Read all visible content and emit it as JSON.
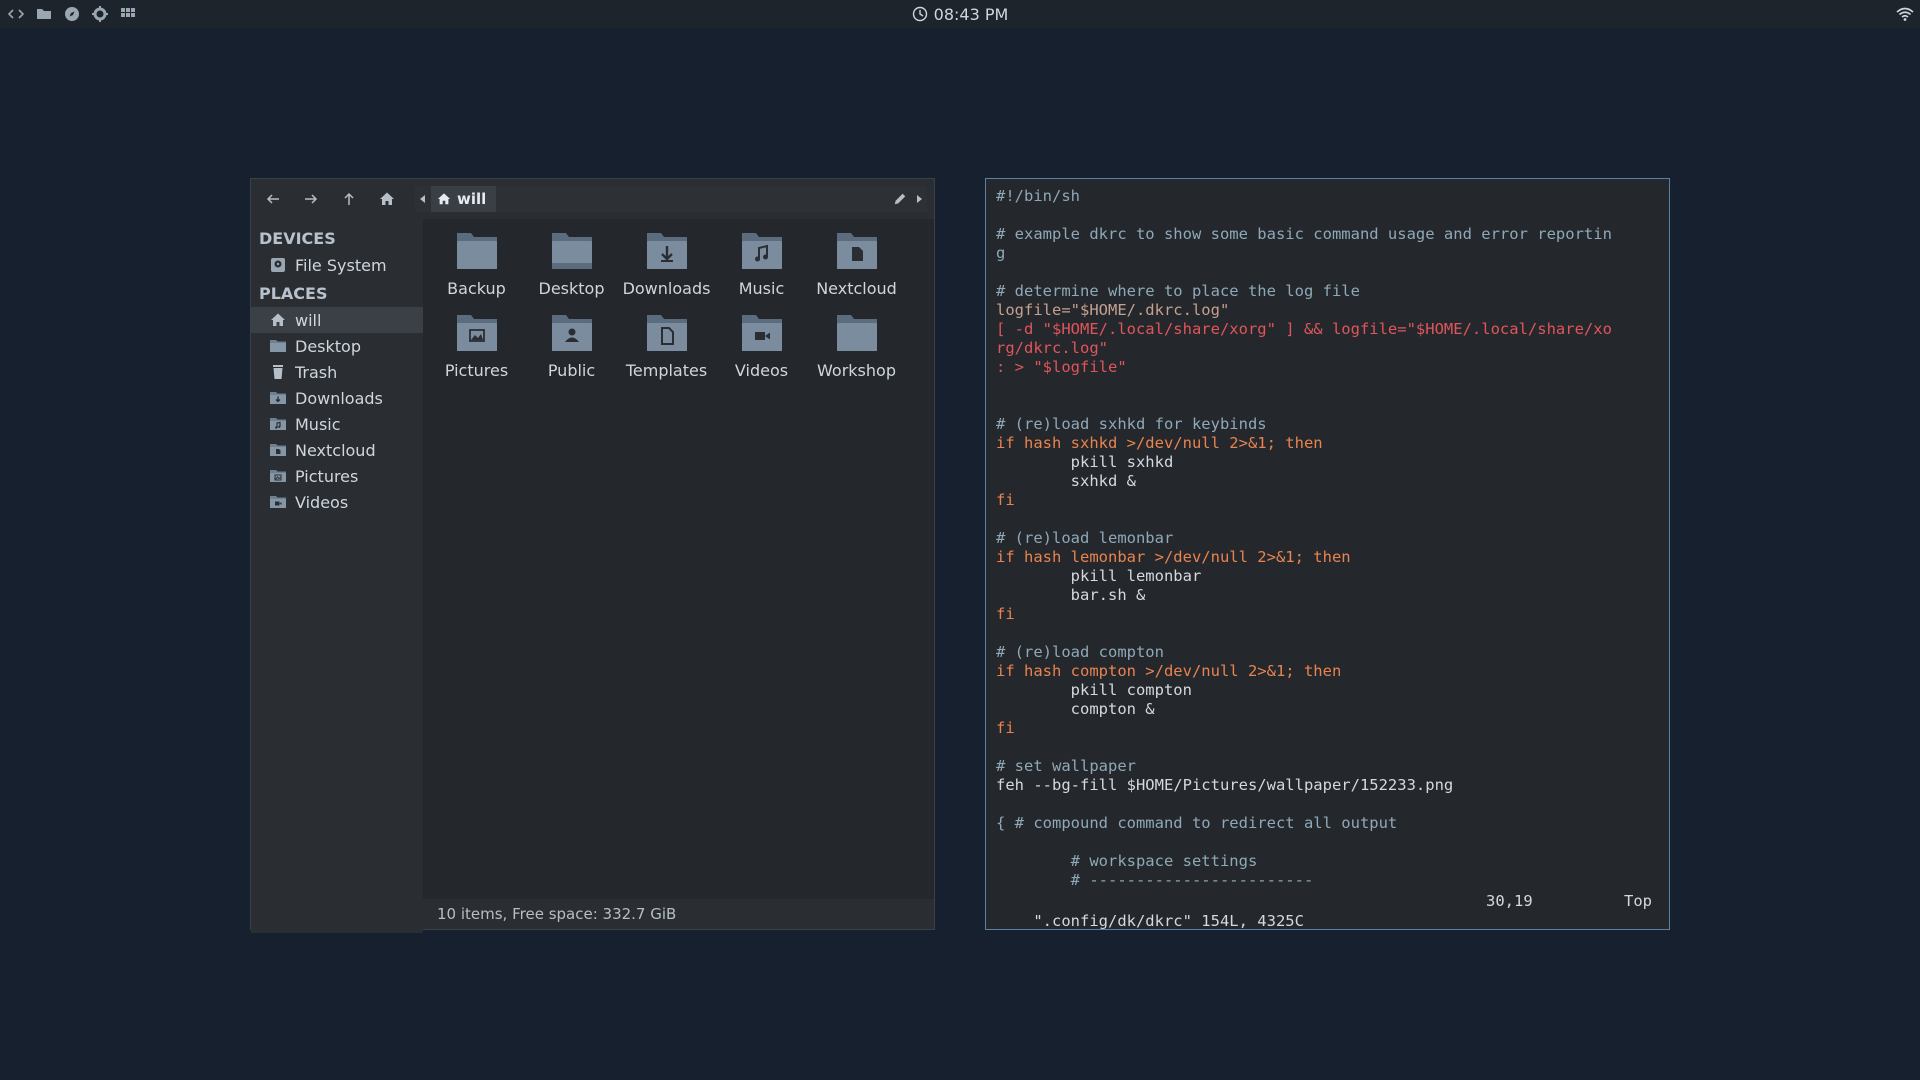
{
  "topbar": {
    "icons": [
      "code-icon",
      "folder-icon",
      "compass-icon",
      "gear-icon",
      "grid-icon"
    ],
    "clock": "08:43 PM"
  },
  "file_manager": {
    "path": {
      "crumb": "will"
    },
    "sidebar": {
      "devices_heading": "DEVICES",
      "devices": [
        {
          "label": "File System",
          "icon": "drive-icon"
        }
      ],
      "places_heading": "PLACES",
      "places": [
        {
          "label": "will",
          "icon": "home-icon",
          "active": true
        },
        {
          "label": "Desktop",
          "icon": "desktop-folder-icon"
        },
        {
          "label": "Trash",
          "icon": "trash-icon"
        },
        {
          "label": "Downloads",
          "icon": "downloads-folder-icon"
        },
        {
          "label": "Music",
          "icon": "music-folder-icon"
        },
        {
          "label": "Nextcloud",
          "icon": "nextcloud-folder-icon"
        },
        {
          "label": "Pictures",
          "icon": "pictures-folder-icon"
        },
        {
          "label": "Videos",
          "icon": "videos-folder-icon"
        }
      ]
    },
    "items": [
      {
        "label": "Backup",
        "icon": "folder-icon"
      },
      {
        "label": "Desktop",
        "icon": "desktop-folder-icon"
      },
      {
        "label": "Downloads",
        "icon": "downloads-folder-icon"
      },
      {
        "label": "Music",
        "icon": "music-folder-icon"
      },
      {
        "label": "Nextcloud",
        "icon": "nextcloud-folder-icon"
      },
      {
        "label": "Pictures",
        "icon": "pictures-folder-icon"
      },
      {
        "label": "Public",
        "icon": "public-folder-icon"
      },
      {
        "label": "Templates",
        "icon": "templates-folder-icon"
      },
      {
        "label": "Videos",
        "icon": "videos-folder-icon"
      },
      {
        "label": "Workshop",
        "icon": "folder-icon"
      }
    ],
    "status": "10 items, Free space: 332.7 GiB"
  },
  "terminal": {
    "lines": [
      "#!/bin/sh",
      "",
      "# example dkrc to show some basic command usage and error reportin",
      "g",
      "",
      "# determine where to place the log file",
      "logfile=\"$HOME/.dkrc.log\"",
      "[ -d \"$HOME/.local/share/xorg\" ] && logfile=\"$HOME/.local/share/xo",
      "rg/dkrc.log\"",
      ": > \"$logfile\"",
      "",
      "",
      "# (re)load sxhkd for keybinds",
      "if hash sxhkd >/dev/null 2>&1; then",
      "        pkill sxhkd",
      "        sxhkd &",
      "fi",
      "",
      "# (re)load lemonbar",
      "if hash lemonbar >/dev/null 2>&1; then",
      "        pkill lemonbar",
      "        bar.sh &",
      "fi",
      "",
      "# (re)load compton",
      "if hash compton >/dev/null 2>&1; then",
      "        pkill compton",
      "        compton &",
      "fi",
      "",
      "# set wallpaper",
      "feh --bg-fill $HOME/Pictures/wallpaper/152233.png",
      "",
      "{ # compound command to redirect all output",
      "",
      "        # workspace settings",
      "        # ------------------------"
    ],
    "status": {
      "file": "\".config/dk/dkrc\" 154L, 4325C",
      "position": "30,19",
      "scroll": "Top"
    }
  }
}
